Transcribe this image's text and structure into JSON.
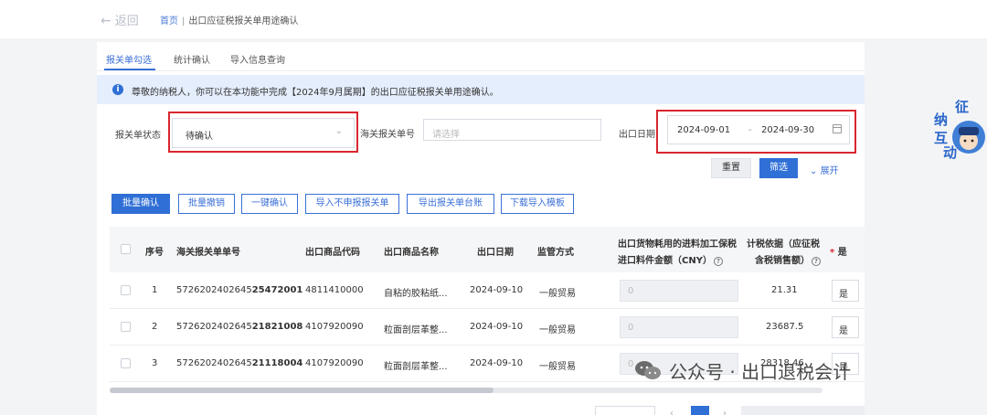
{
  "header": {
    "back_label": "返回",
    "breadcrumb_home": "首页",
    "breadcrumb_sep": "|",
    "breadcrumb_current": "出口应征税报关单用途确认"
  },
  "tabs": [
    {
      "label": "报关单勾选",
      "active": true
    },
    {
      "label": "统计确认",
      "active": false
    },
    {
      "label": "导入信息查询",
      "active": false
    }
  ],
  "notice": {
    "icon": "info-icon",
    "text": "尊敬的纳税人，你可以在本功能中完成【2024年9月属期】的出口应征税报关单用途确认。"
  },
  "filters": {
    "status_label": "报关单状态",
    "status_value": "待确认",
    "declaration_no_label": "海关报关单号",
    "declaration_no_placeholder": "请选择",
    "export_date_label": "出口日期",
    "date_start": "2024-09-01",
    "date_sep": "-",
    "date_end": "2024-09-30"
  },
  "filter_actions": {
    "reset_label": "重置",
    "search_label": "筛选",
    "expand_label": "展开"
  },
  "toolbar": {
    "batch_confirm": "批量确认",
    "batch_revoke": "批量撤销",
    "one_click_confirm": "一键确认",
    "import_not_declared": "导入不申报报关单",
    "export_ledger": "导出报关单台账",
    "download_template": "下载导入模板"
  },
  "table": {
    "headers": {
      "no": "序号",
      "declaration_no": "海关报关单单号",
      "goods_code": "出口商品代码",
      "goods_name": "出口商品名称",
      "export_date": "出口日期",
      "supervision": "监管方式",
      "amount_line1": "出口货物耗用的进料加工保税",
      "amount_line2": "进口料件金额（CNY）",
      "basis_line1": "计税依据（应征税",
      "basis_line2": "含税销售额）",
      "last": "是"
    },
    "rows": [
      {
        "no": "1",
        "decl_prefix": "5726202402645",
        "decl_suffix": "25472001",
        "goods_code": "4811410000",
        "goods_name": "自粘的胶粘纸...",
        "export_date": "2024-09-10",
        "supervision": "一般贸易",
        "amount_placeholder": "0",
        "basis": "21.31",
        "flag": "是"
      },
      {
        "no": "2",
        "decl_prefix": "5726202402645",
        "decl_suffix": "21821008",
        "goods_code": "4107920090",
        "goods_name": "粒面剖层革整...",
        "export_date": "2024-09-10",
        "supervision": "一般贸易",
        "amount_placeholder": "0",
        "basis": "23687.5",
        "flag": "是"
      },
      {
        "no": "3",
        "decl_prefix": "5726202402645",
        "decl_suffix": "21118004",
        "goods_code": "4107920090",
        "goods_name": "粒面剖层革整...",
        "export_date": "2024-09-10",
        "supervision": "一般贸易",
        "amount_placeholder": "0",
        "basis": "28318.46",
        "flag": "是"
      }
    ]
  },
  "badge": {
    "chars": [
      "征",
      "纳",
      "互",
      "动"
    ]
  },
  "watermark": {
    "text": "公众号 · 出口退税会计"
  },
  "colors": {
    "primary": "#2f6fd6",
    "highlight_box": "#d9262f",
    "notice_bg": "#e4eefc"
  }
}
